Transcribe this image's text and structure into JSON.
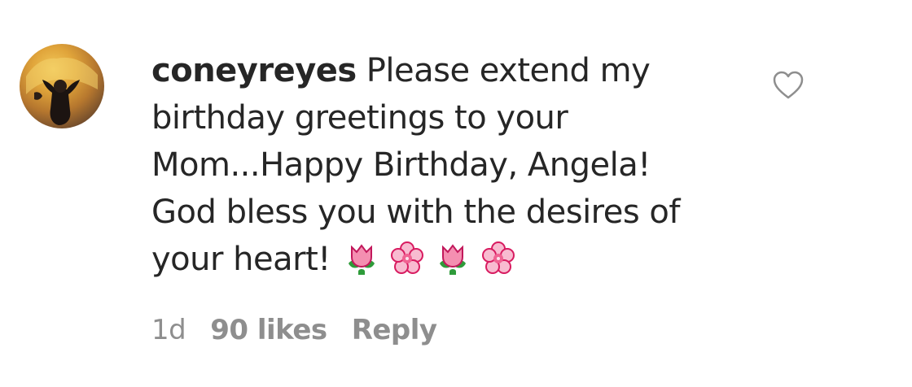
{
  "comment": {
    "username": "coneyreyes",
    "text_lines": [
      "Please extend my",
      "birthday greetings to your",
      "Mom...Happy Birthday, Angela!",
      "God bless you with the desires of",
      "your heart!"
    ],
    "emojis": [
      "tulip-icon",
      "cherry-blossom-icon",
      "tulip-icon",
      "cherry-blossom-icon"
    ],
    "time_ago": "1d",
    "likes": "90 likes",
    "reply_label": "Reply"
  },
  "colors": {
    "text": "#262626",
    "muted": "#8e8e8e",
    "heart": "#8e8e8e"
  },
  "icons": {
    "like": "heart-outline-icon",
    "avatar": "profile-avatar"
  }
}
